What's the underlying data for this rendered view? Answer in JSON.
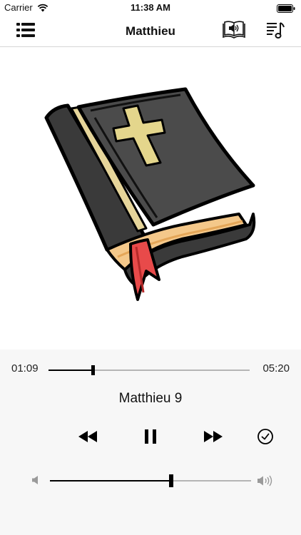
{
  "status_bar": {
    "carrier": "Carrier",
    "time": "11:38 AM"
  },
  "nav": {
    "title": "Matthieu",
    "left_icon": "list-icon",
    "right_icons": [
      "audio-bible-icon",
      "playlist-music-icon"
    ]
  },
  "artwork": {
    "subject": "bible-book-icon"
  },
  "player": {
    "elapsed": "01:09",
    "duration": "05:20",
    "progress": 0.22,
    "track_title": "Matthieu 9",
    "volume": 0.6,
    "controls": [
      "rewind-icon",
      "pause-icon",
      "fast-forward-icon",
      "timer-icon"
    ]
  },
  "colors": {
    "accent": "#000000",
    "track_inactive": "#b5b5b5",
    "player_background": "#f7f7f7"
  }
}
